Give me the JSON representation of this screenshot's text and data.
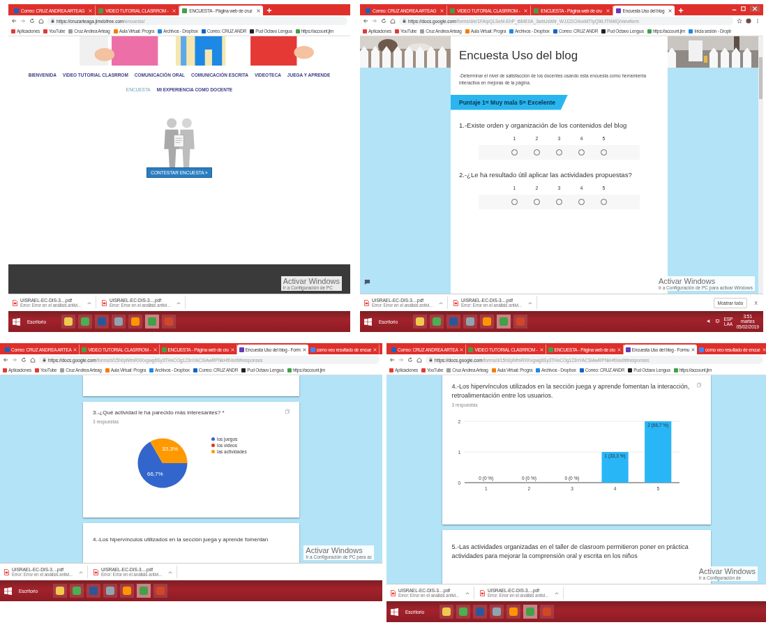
{
  "panels": [
    {
      "tabs": [
        {
          "label": "Correo: CRUZ ANDREA ARTEAG",
          "selected": false,
          "color": "#1565c0"
        },
        {
          "label": "VIDEO TUTORIAL CLASRROM - ",
          "selected": false,
          "color": "#43a047"
        },
        {
          "label": "ENCUESTA - Página web de cruz",
          "selected": true,
          "color": "#43a047"
        }
      ],
      "url": {
        "host": "https://cruzarteaga.jimdofree.com",
        "path": "/encuesta/"
      },
      "bookmarks": [
        {
          "label": "Aplicaciones",
          "color": "#e53935"
        },
        {
          "label": "YouTube",
          "color": "#e53935"
        },
        {
          "label": "Cruz Andrea Arteag",
          "color": "#9e9e9e"
        },
        {
          "label": "Aula Virtual: Progra",
          "color": "#f57c00"
        },
        {
          "label": "Archivos - Dropbox",
          "color": "#1e88e5"
        },
        {
          "label": "Correo: CRUZ ANDR",
          "color": "#1565c0"
        },
        {
          "label": "Pud Octavo Lengua",
          "color": "#212121"
        },
        {
          "label": "https://account.jim",
          "color": "#43a047"
        }
      ],
      "content": {
        "kind": "site",
        "menu_rows": [
          [
            {
              "label": "BIENVENIDA",
              "selected": false
            },
            {
              "label": "VIDEO TUTORIAL CLASRROM",
              "selected": false
            },
            {
              "label": "COMUNICACIÓN ORAL",
              "selected": false
            },
            {
              "label": "COMUNICACIÓN ESCRITA",
              "selected": false
            },
            {
              "label": "VIDEOTECA",
              "selected": false
            },
            {
              "label": "JUEGA Y APRENDE",
              "selected": false
            }
          ],
          [
            {
              "label": "ENCUESTA",
              "selected": true
            },
            {
              "label": "MI EXPERIENCIA COMO DOCENTE",
              "selected": false
            }
          ]
        ],
        "cta": "CONTESTAR ENCUESTA »"
      },
      "activation": {
        "title": "Activar Windows",
        "note": "Ir a Configuración de PC"
      },
      "downloads": [
        {
          "name": "UISRAEL-EC-DIS-3....pdf",
          "status": "Error: Error en el análisis antivi..."
        },
        {
          "name": "UISRAEL-EC-DIS-3....pdf",
          "status": "Error: Error en el análisis antivi..."
        }
      ],
      "taskbar": {
        "start_label": "Escritorio",
        "apps": [
          {
            "color": "#f2c94c",
            "selected": false
          },
          {
            "color": "#4caf50",
            "selected": false
          },
          {
            "color": "#2b579a",
            "selected": false
          },
          {
            "color": "#90a4ae",
            "selected": false
          },
          {
            "color": "#ff9500",
            "selected": false
          },
          {
            "color": "#43a047",
            "selected": true
          },
          {
            "color": "#d24726",
            "selected": false
          }
        ]
      }
    },
    {
      "tabs": [
        {
          "label": "Correo: CRUZ ANDREA ARTEAG",
          "selected": false,
          "color": "#1565c0"
        },
        {
          "label": "VIDEO TUTORIAL CLASRROM - ",
          "selected": false,
          "color": "#43a047"
        },
        {
          "label": "ENCUESTA - Página web de cru",
          "selected": false,
          "color": "#43a047"
        },
        {
          "label": "Encuesta Uso del blog",
          "selected": true,
          "color": "#673ab7"
        }
      ],
      "url": {
        "host": "https://docs.google.com",
        "path": "/forms/d/e/1FAIpQLSeM-EhP_t6MEIIA_3wbUsWtr_WJJ22Cl4oxMTtyQ9iLfTNWQ/viewform"
      },
      "bookmarks": [
        {
          "label": "Aplicaciones",
          "color": "#e53935"
        },
        {
          "label": "YouTube",
          "color": "#e53935"
        },
        {
          "label": "Cruz Andrea Arteag",
          "color": "#9e9e9e"
        },
        {
          "label": "Aula Virtual: Progra",
          "color": "#f57c00"
        },
        {
          "label": "Archivos - Dropbox",
          "color": "#1e88e5"
        },
        {
          "label": "Correo: CRUZ ANDR",
          "color": "#1565c0"
        },
        {
          "label": "Pud Octavo Lengua",
          "color": "#212121"
        },
        {
          "label": "https://account.jim",
          "color": "#43a047"
        },
        {
          "label": "Inicia sesión - Dropb",
          "color": "#1e88e5"
        }
      ],
      "content": {
        "kind": "form",
        "title": "Encuesta Uso del blog",
        "description": "-Determinar el nivel de satisfacción de los docentes usando esta encuesta como herramienta interactiva en mejoras de la página.",
        "score_banner": "Puntaje 1= Muy mala 5= Excelente",
        "questions": [
          {
            "text": "1.-Existe orden y organización de los contenidos del blog",
            "options": [
              {
                "label": "1",
                "selected": false
              },
              {
                "label": "2",
                "selected": false
              },
              {
                "label": "3",
                "selected": false
              },
              {
                "label": "4",
                "selected": false
              },
              {
                "label": "5",
                "selected": false
              }
            ]
          },
          {
            "text": "2.-¿Le ha resultado útil aplicar las actividades propuestas?",
            "options": [
              {
                "label": "1",
                "selected": false
              },
              {
                "label": "2",
                "selected": false
              },
              {
                "label": "3",
                "selected": false
              },
              {
                "label": "4",
                "selected": false
              },
              {
                "label": "5",
                "selected": false
              }
            ]
          }
        ]
      },
      "activation": {
        "title": "Activar Windows",
        "note": "Ir a Configuración de PC para activar Windows"
      },
      "downloads": [
        {
          "name": "UISRAEL-EC-DIS-3....pdf",
          "status": "Error: Error en el análisis antivi..."
        },
        {
          "name": "UISRAEL-EC-DIS-3....pdf",
          "status": "Error: Error en el análisis antivi..."
        }
      ],
      "download_actions": {
        "show_all": "Mostrar todo",
        "close": "X"
      },
      "taskbar": {
        "start_label": "Escritorio",
        "apps": [
          {
            "color": "#f2c94c",
            "selected": false
          },
          {
            "color": "#4caf50",
            "selected": false
          },
          {
            "color": "#2b579a",
            "selected": false
          },
          {
            "color": "#90a4ae",
            "selected": false
          },
          {
            "color": "#ff9500",
            "selected": false
          },
          {
            "color": "#43a047",
            "selected": true
          },
          {
            "color": "#d24726",
            "selected": false
          }
        ],
        "tray": {
          "lang": "ESP",
          "region": "LAA",
          "time": "3:51",
          "day": "martes",
          "date": "05/02/2019"
        }
      }
    },
    {
      "tabs": [
        {
          "label": "Correo: CRUZ ANDREA ARTEA",
          "selected": false,
          "color": "#1565c0"
        },
        {
          "label": "VIDEO TUTORIAL CLASRROM -",
          "selected": false,
          "color": "#43a047"
        },
        {
          "label": "ENCUESTA - Página web de cru",
          "selected": false,
          "color": "#43a047"
        },
        {
          "label": "Encuesta Uso del blog - Form",
          "selected": true,
          "color": "#673ab7"
        },
        {
          "label": "como veo resultado de encue",
          "selected": false,
          "color": "#4285f4"
        }
      ],
      "url": {
        "host": "https://docs.google.com",
        "path": "/forms/d/15h0pNfmRXKxgwg6Sy3THxCOg123nYACSiAwRPNkHf0/edit#responses"
      },
      "bookmarks": [
        {
          "label": "Aplicaciones",
          "color": "#e53935"
        },
        {
          "label": "YouTube",
          "color": "#e53935"
        },
        {
          "label": "Cruz Andrea Arteag",
          "color": "#9e9e9e"
        },
        {
          "label": "Aula Virtual: Progra",
          "color": "#f57c00"
        },
        {
          "label": "Archivos - Dropbox",
          "color": "#1e88e5"
        },
        {
          "label": "Correo: CRUZ ANDR",
          "color": "#1565c0"
        },
        {
          "label": "Pud Octavo Lengua",
          "color": "#212121"
        },
        {
          "label": "https://account.jim",
          "color": "#43a047"
        }
      ],
      "content": {
        "kind": "responses",
        "cards": [
          {
            "question": "3.-¿Qué actividad le ha parecido más interesantes? *",
            "responses": "3 respuestas",
            "chart_data": {
              "type": "pie",
              "categories": [
                "los juegos",
                "los videos",
                "las actividades"
              ],
              "legend": "right",
              "series": [
                {
                  "values": [
                    66.7,
                    0,
                    33.3
                  ]
                }
              ],
              "colors": [
                "#3366cc",
                "#dc3912",
                "#ff9900"
              ],
              "value_labels": [
                "66,7%",
                null,
                "33,3%"
              ]
            }
          },
          {
            "question": "4.-Los hipervínculos utilizados en la sección juega y aprende fomentan"
          }
        ]
      },
      "activation": {
        "title": "Activar Windows",
        "note": "Ir a Configuración de PC para ac"
      },
      "downloads": [
        {
          "name": "UISRAEL-EC-DIS-3....pdf",
          "status": "Error: Error en el análisis antivi..."
        },
        {
          "name": "UISRAEL-EC-DIS-3....pdf",
          "status": "Error: Error en el análisis antivi..."
        }
      ],
      "taskbar": {
        "start_label": "Escritorio",
        "apps": [
          {
            "color": "#f2c94c",
            "selected": false
          },
          {
            "color": "#4caf50",
            "selected": false
          },
          {
            "color": "#2b579a",
            "selected": false
          },
          {
            "color": "#90a4ae",
            "selected": false
          },
          {
            "color": "#ff9500",
            "selected": false
          },
          {
            "color": "#43a047",
            "selected": true
          },
          {
            "color": "#d24726",
            "selected": false
          }
        ]
      }
    },
    {
      "tabs": [
        {
          "label": "Correo: CRUZ ANDREA ARTEA",
          "selected": false,
          "color": "#1565c0"
        },
        {
          "label": "VIDEO TUTORIAL CLASRROM -",
          "selected": false,
          "color": "#43a047"
        },
        {
          "label": "ENCUESTA - Página web de cru",
          "selected": false,
          "color": "#43a047"
        },
        {
          "label": "Encuesta Uso del blog - Formu",
          "selected": true,
          "color": "#673ab7"
        },
        {
          "label": "como veo resultado de encue",
          "selected": false,
          "color": "#4285f4"
        }
      ],
      "url": {
        "host": "https://docs.google.com",
        "path": "/forms/d/15h0pNfmRXKxgwg6Sy3THxCOg123nYACSiAwRPNkHf0/edit#responses"
      },
      "bookmarks": [
        {
          "label": "Aplicaciones",
          "color": "#e53935"
        },
        {
          "label": "YouTube",
          "color": "#e53935"
        },
        {
          "label": "Cruz Andrea Arteag",
          "color": "#9e9e9e"
        },
        {
          "label": "Aula Virtual: Progra",
          "color": "#f57c00"
        },
        {
          "label": "Archivos - Dropbox",
          "color": "#1e88e5"
        },
        {
          "label": "Correo: CRUZ ANDR",
          "color": "#1565c0"
        },
        {
          "label": "Pud Octavo Lengua",
          "color": "#212121"
        },
        {
          "label": "https://account.jim",
          "color": "#43a047"
        }
      ],
      "content": {
        "kind": "responses",
        "cards": [
          {
            "question": "4.-Los hipervínculos utilizados en la sección juega y aprende fomentan la interacción, retroalimentación entre los usuarios.",
            "responses": "3 respuestas",
            "chart_data": {
              "type": "bar",
              "categories": [
                "1",
                "2",
                "3",
                "4",
                "5"
              ],
              "series": [
                {
                  "color": "#29b6f6",
                  "values": [
                    0,
                    0,
                    0,
                    1,
                    2
                  ]
                }
              ],
              "ylim": [
                0,
                2
              ],
              "yticks": [
                0,
                1,
                2
              ],
              "value_labels": [
                "0 (0 %)",
                "0 (0 %)",
                "0 (0 %)",
                "1 (33,3 %)",
                "2 (66,7 %)"
              ]
            }
          },
          {
            "question": "5.-Las actividades organizadas en el taller de clasroom permitieron poner en práctica actividades para mejorar la comprensión oral y escrita en los niños"
          }
        ]
      },
      "activation": {
        "title": "Activar Windows",
        "note": "Ir a Configuración de"
      },
      "downloads": [
        {
          "name": "UISRAEL-EC-DIS-3....pdf",
          "status": "Error: Error en el análisis antivi..."
        },
        {
          "name": "UISRAEL-EC-DIS-3....pdf",
          "status": "Error: Error en el análisis antivi..."
        }
      ],
      "taskbar": {
        "start_label": "Escritorio",
        "apps": [
          {
            "color": "#f2c94c",
            "selected": false
          },
          {
            "color": "#4caf50",
            "selected": false
          },
          {
            "color": "#2b579a",
            "selected": false
          },
          {
            "color": "#90a4ae",
            "selected": false
          },
          {
            "color": "#ff9500",
            "selected": false
          },
          {
            "color": "#43a047",
            "selected": true
          },
          {
            "color": "#d24726",
            "selected": false
          }
        ]
      }
    }
  ]
}
